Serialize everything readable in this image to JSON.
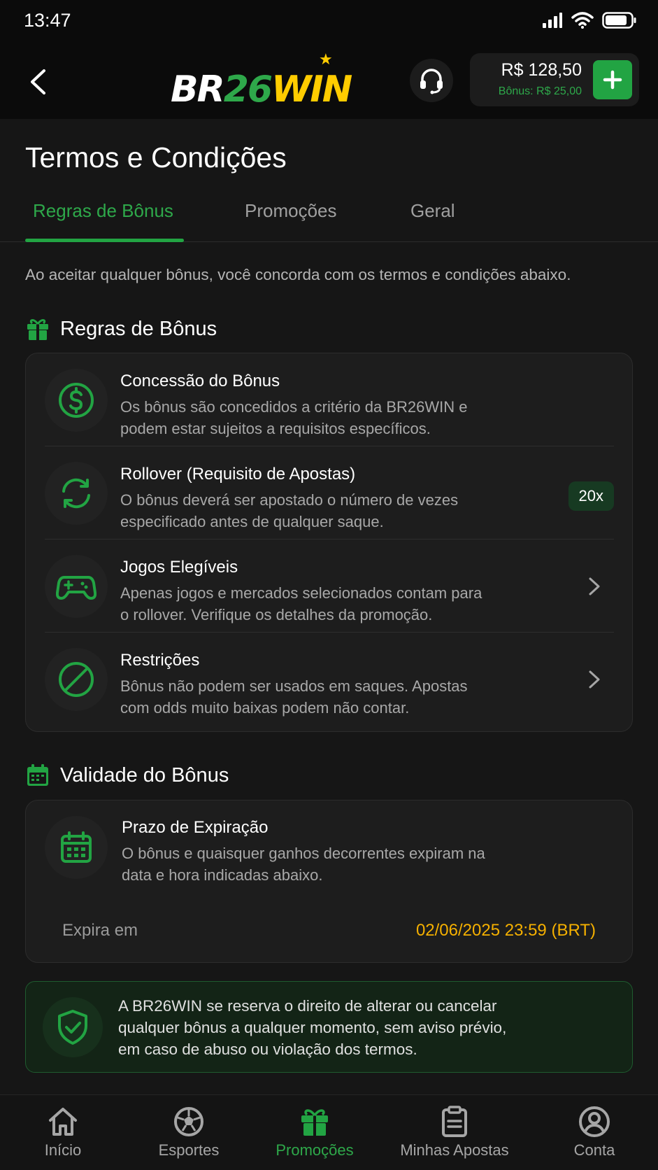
{
  "status_bar": {
    "time": "13:47"
  },
  "header": {
    "logo": {
      "part1": "BR",
      "part2": "26",
      "part3": "WIN"
    },
    "balance": "R$ 128,50",
    "bonus_balance": "Bônus: R$ 25,00"
  },
  "page": {
    "title": "Termos e Condições",
    "tabs": [
      {
        "label": "Regras de Bônus",
        "active": true
      },
      {
        "label": "Promoções",
        "active": false
      },
      {
        "label": "Geral",
        "active": false
      }
    ],
    "intro": "Ao aceitar qualquer bônus, você concorda com os termos e condições abaixo."
  },
  "bonus_rules": {
    "heading": "Regras de Bônus",
    "items": [
      {
        "title": "Concessão do Bônus",
        "desc_line1": "Os bônus são concedidos a critério da BR26WIN e",
        "desc_line2": "podem estar sujeitos a requisitos específicos.",
        "icon": "dollar-circle-icon"
      },
      {
        "title": "Rollover (Requisito de Apostas)",
        "desc_line1": "O bônus deverá ser apostado o número de vezes",
        "desc_line2": "especificado antes de qualquer saque.",
        "badge": "20x",
        "icon": "refresh-icon"
      },
      {
        "title": "Jogos Elegíveis",
        "desc_line1": "Apenas jogos e mercados selecionados contam para",
        "desc_line2": "o rollover. Verifique os detalhes da promoção.",
        "icon": "gamepad-icon"
      },
      {
        "title": "Restrições",
        "desc_line1": "Bônus não podem ser usados em saques. Apostas",
        "desc_line2": "com odds muito baixas podem não contar.",
        "icon": "ban-icon"
      }
    ]
  },
  "validity": {
    "heading": "Validade do Bônus",
    "title": "Prazo de Expiração",
    "desc_line1": "O bônus e quaisquer ganhos decorrentes expiram na",
    "desc_line2": "data e hora indicadas abaixo.",
    "expires_label": "Expira em",
    "expires_value": "02/06/2025 23:59 (BRT)"
  },
  "notice": {
    "line1": "A BR26WIN se reserva o direito de alterar ou cancelar",
    "line2": "qualquer bônus a qualquer momento, sem aviso prévio,",
    "line3": "em caso de abuso ou violação dos termos."
  },
  "bottom_nav": [
    {
      "label": "Início",
      "icon": "home-icon",
      "active": false
    },
    {
      "label": "Esportes",
      "icon": "soccer-ball-icon",
      "active": false
    },
    {
      "label": "Promoções",
      "icon": "gift-icon",
      "active": true
    },
    {
      "label": "Minhas Apostas",
      "icon": "clipboard-icon",
      "active": false
    },
    {
      "label": "Conta",
      "icon": "user-circle-icon",
      "active": false
    }
  ],
  "colors": {
    "accent_green": "#22a443",
    "expiry_orange": "#f5b000",
    "background": "#161616"
  }
}
